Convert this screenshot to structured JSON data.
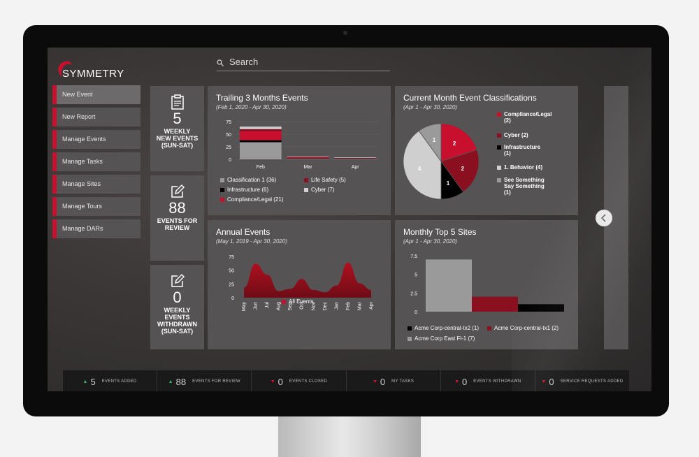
{
  "app": {
    "name": "SYMMETRY"
  },
  "search": {
    "placeholder": "Search"
  },
  "nav": {
    "items": [
      "New Event",
      "New Report",
      "Manage Events",
      "Manage Tasks",
      "Manage Sites",
      "Manage Tours",
      "Manage DARs"
    ]
  },
  "stats": [
    {
      "value": "5",
      "label_lines": [
        "WEEKLY",
        "NEW EVENTS",
        "(SUN-SAT)"
      ],
      "icon": "clipboard-icon"
    },
    {
      "value": "88",
      "label_lines": [
        "EVENTS FOR",
        "REVIEW"
      ],
      "icon": "edit-icon"
    },
    {
      "value": "0",
      "label_lines": [
        "WEEKLY",
        "EVENTS",
        "WITHDRAWN",
        "(SUN-SAT)"
      ],
      "icon": "edit-icon"
    }
  ],
  "footer": [
    {
      "direction": "up",
      "value": "5",
      "label": "EVENTS ADDED"
    },
    {
      "direction": "up",
      "value": "88",
      "label": "EVENTS FOR REVIEW"
    },
    {
      "direction": "down",
      "value": "0",
      "label": "EVENTS CLOSED"
    },
    {
      "direction": "down",
      "value": "0",
      "label": "MY TASKS"
    },
    {
      "direction": "down",
      "value": "0",
      "label": "EVENTS WITHDRAWN"
    },
    {
      "direction": "down",
      "value": "0",
      "label": "SERVICE REQUESTS ADDED"
    }
  ],
  "colors": {
    "accent": "#c8102e",
    "dark_red": "#8a1020",
    "gray": "#9a9a9a",
    "light_gray": "#cfcfcf",
    "panel": "#555354",
    "black": "#000000"
  },
  "chart_data": [
    {
      "type": "bar",
      "title": "Trailing 3 Months Events",
      "subtitle": "(Feb 1, 2020 - Apr 30, 2020)",
      "categories": [
        "Feb",
        "Mar",
        "Apr"
      ],
      "y_ticks": [
        "0",
        "25",
        "50",
        "75"
      ],
      "ylim": [
        0,
        75
      ],
      "stacked": true,
      "series": [
        {
          "name": "Classification 1 (36)",
          "color": "#9a9a9a",
          "values": [
            34,
            1,
            1
          ]
        },
        {
          "name": "Infrastructure (6)",
          "color": "#000000",
          "values": [
            4,
            1,
            1
          ]
        },
        {
          "name": "Compliance/Legal (21)",
          "color": "#c8102e",
          "values": [
            18,
            2,
            1
          ]
        },
        {
          "name": "Life Safety (5)",
          "color": "#8a1020",
          "values": [
            4,
            1,
            0
          ]
        },
        {
          "name": "Cyber (7)",
          "color": "#cfcfcf",
          "values": [
            5,
            1,
            1
          ]
        }
      ]
    },
    {
      "type": "pie",
      "title": "Current Month Event Classifications",
      "subtitle": "(Apr 1 - Apr 30, 2020)",
      "slices": [
        {
          "name": "Compliance/Legal (2)",
          "value": 2,
          "color": "#c8102e",
          "label": "2"
        },
        {
          "name": "Cyber (2)",
          "value": 2,
          "color": "#8a1020",
          "label": "2"
        },
        {
          "name": "Infrastructure (1)",
          "value": 1,
          "color": "#000000",
          "label": "1"
        },
        {
          "name": "1. Behavior (4)",
          "value": 4,
          "color": "#cfcfcf",
          "label": "4"
        },
        {
          "name": "See Something Say Something (1)",
          "value": 1,
          "color": "#9a9a9a",
          "label": "1"
        }
      ]
    },
    {
      "type": "area",
      "title": "Annual Events",
      "subtitle": "(May 1, 2019 - Apr 30, 2020)",
      "categories": [
        "May",
        "Jun",
        "Jul",
        "Aug",
        "Sep",
        "Oct",
        "Nov",
        "Dec",
        "Jan",
        "Feb",
        "Mar",
        "Apr"
      ],
      "y_ticks": [
        "0",
        "25",
        "50",
        "75"
      ],
      "ylim": [
        0,
        75
      ],
      "series": [
        {
          "name": "All Events",
          "color": "#c8102e",
          "values": [
            18,
            62,
            42,
            12,
            16,
            34,
            14,
            10,
            22,
            64,
            26,
            14
          ]
        }
      ]
    },
    {
      "type": "bar",
      "title": "Monthly Top 5 Sites",
      "subtitle": "(Apr 1 - Apr 30, 2020)",
      "y_ticks": [
        "0",
        "2.5",
        "5",
        "7.5"
      ],
      "ylim": [
        0,
        7.5
      ],
      "series": [
        {
          "name": "Acme Corp East Fl-1 (7)",
          "color": "#9a9a9a",
          "value": 7
        },
        {
          "name": "Acme Corp-central-tx1 (2)",
          "color": "#8a1020",
          "value": 2
        },
        {
          "name": "Acme Corp-central-tx2 (1)",
          "color": "#000000",
          "value": 1
        }
      ]
    }
  ]
}
